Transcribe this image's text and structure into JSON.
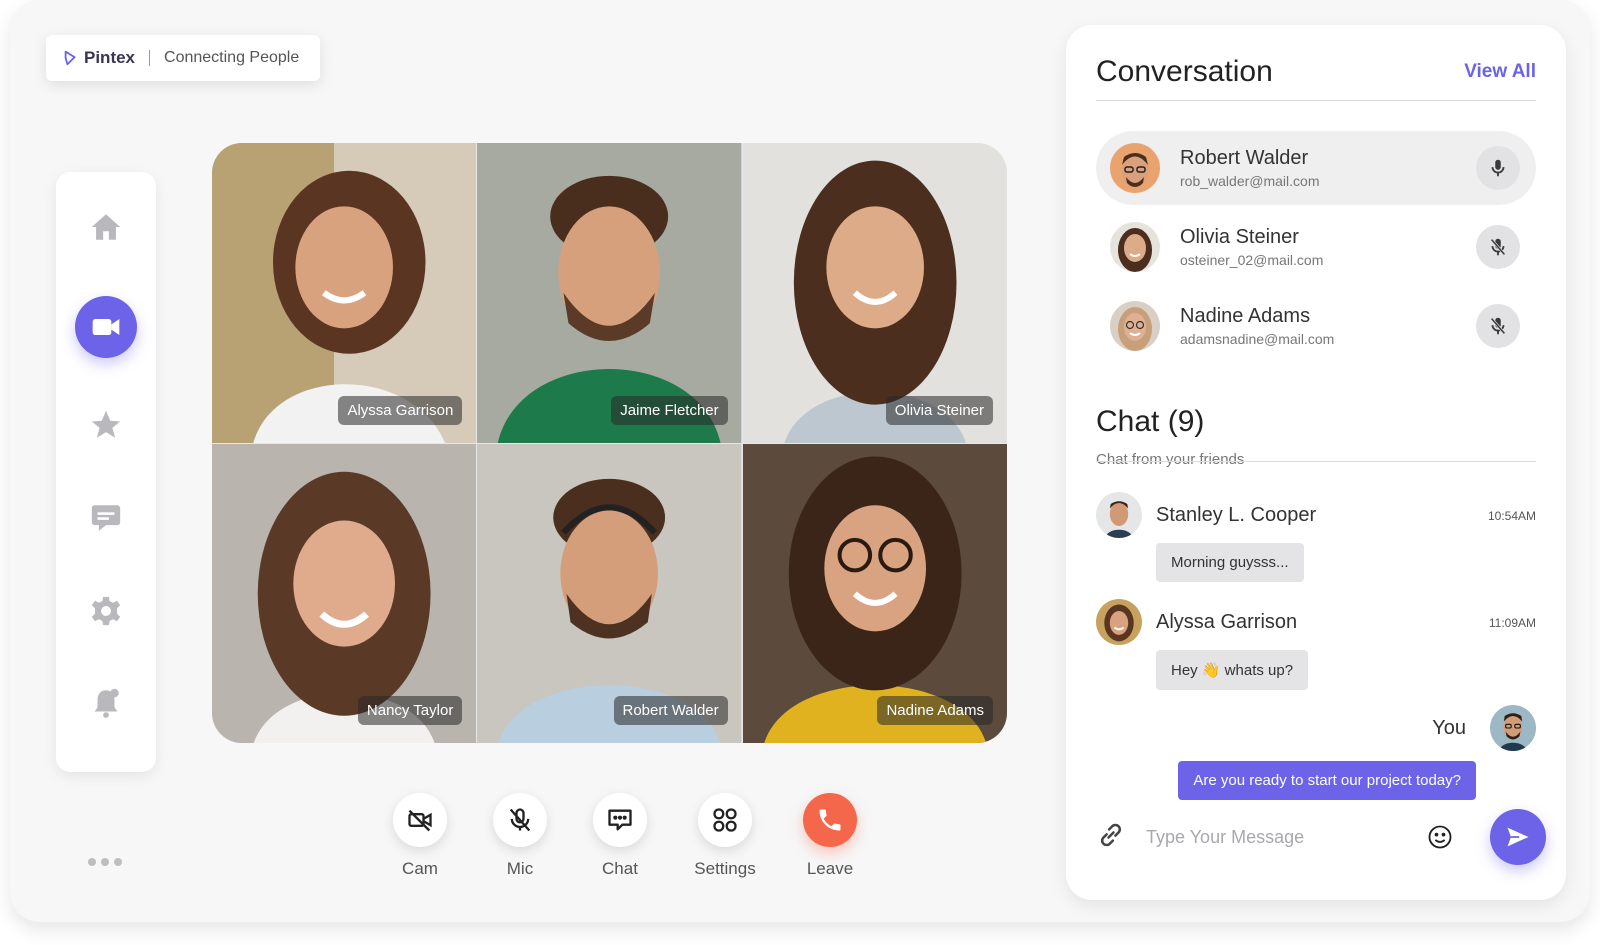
{
  "brand": {
    "name": "Pintex",
    "tagline": "Connecting People"
  },
  "sidebar": {
    "items": [
      {
        "icon": "home-icon",
        "active": false
      },
      {
        "icon": "video-icon",
        "active": true
      },
      {
        "icon": "star-icon",
        "active": false
      },
      {
        "icon": "chat-icon",
        "active": false
      },
      {
        "icon": "gear-icon",
        "active": false
      },
      {
        "icon": "bell-icon",
        "active": false
      }
    ],
    "more_icon": "more-dots-icon"
  },
  "participants": [
    {
      "name": "Alyssa Garrison"
    },
    {
      "name": "Jaime Fletcher"
    },
    {
      "name": "Olivia Steiner"
    },
    {
      "name": "Nancy Taylor"
    },
    {
      "name": "Robert Walder"
    },
    {
      "name": "Nadine Adams"
    }
  ],
  "controls": [
    {
      "label": "Cam",
      "icon": "camera-off-icon"
    },
    {
      "label": "Mic",
      "icon": "mic-off-icon"
    },
    {
      "label": "Chat",
      "icon": "chat-bubble-icon"
    },
    {
      "label": "Settings",
      "icon": "grid-settings-icon"
    },
    {
      "label": "Leave",
      "icon": "phone-icon"
    }
  ],
  "conversation": {
    "title": "Conversation",
    "view_all": "View All",
    "contacts": [
      {
        "name": "Robert Walder",
        "email": "rob_walder@mail.com",
        "mic": "on",
        "active": true
      },
      {
        "name": "Olivia Steiner",
        "email": "osteiner_02@mail.com",
        "mic": "muted",
        "active": false
      },
      {
        "name": "Nadine Adams",
        "email": "adamsnadine@mail.com",
        "mic": "muted",
        "active": false
      }
    ]
  },
  "chat": {
    "title": "Chat (9)",
    "subtitle": "Chat from your friends",
    "messages": [
      {
        "sender": "Stanley L. Cooper",
        "time": "10:54AM",
        "text": "Morning guysss..."
      },
      {
        "sender": "Alyssa Garrison",
        "time": "11:09AM",
        "text": "Hey 👋 whats up?"
      }
    ],
    "you_label": "You",
    "my_message": "Are you ready to start our project today?",
    "input_placeholder": "Type Your Message"
  },
  "colors": {
    "accent": "#6c63e8",
    "leave": "#f4674a"
  }
}
